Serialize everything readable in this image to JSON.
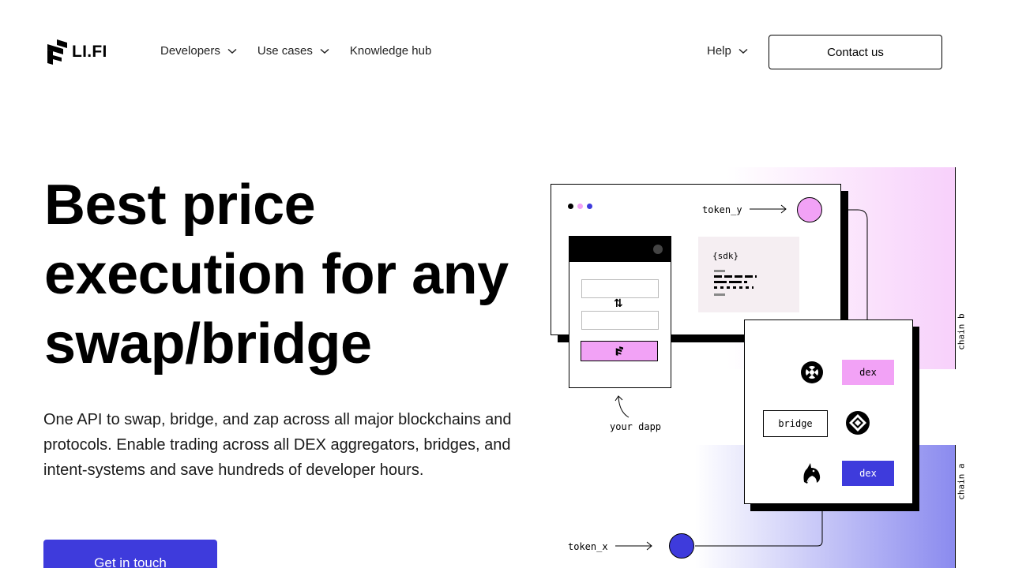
{
  "header": {
    "logo_text": "LI.FI",
    "nav": [
      {
        "label": "Developers",
        "has_dropdown": true
      },
      {
        "label": "Use cases",
        "has_dropdown": true
      },
      {
        "label": "Knowledge hub",
        "has_dropdown": false
      }
    ],
    "help_label": "Help",
    "contact_label": "Contact us"
  },
  "hero": {
    "title_lines": [
      "Best price",
      "execution for any",
      "swap/bridge"
    ],
    "subtitle": "One API to swap, bridge, and zap across all major blockchains and protocols. Enable trading across all DEX aggregators, bridges, and intent-systems and save hundreds of developer hours.",
    "cta_label": "Get in touch"
  },
  "illustration": {
    "token_y": "token_y",
    "token_x": "token_x",
    "sdk_label": "{sdk}",
    "dapp_label": "your dapp",
    "bridge_label": "bridge",
    "dex_top_label": "dex",
    "dex_bottom_label": "dex",
    "chain_b": "chain b",
    "chain_a": "chain a",
    "icons": [
      "logo-icon",
      "chevron-down-icon",
      "swap-arrows-icon",
      "lifi-logo-icon",
      "protocol-x-icon",
      "protocol-diamond-icon",
      "unicorn-icon",
      "arrow-right-icon",
      "curved-arrow-icon"
    ]
  },
  "colors": {
    "accent_blue": "#3e3bdc",
    "pink": "#f2a2f6",
    "dex_blue": "#3e3bdc"
  }
}
